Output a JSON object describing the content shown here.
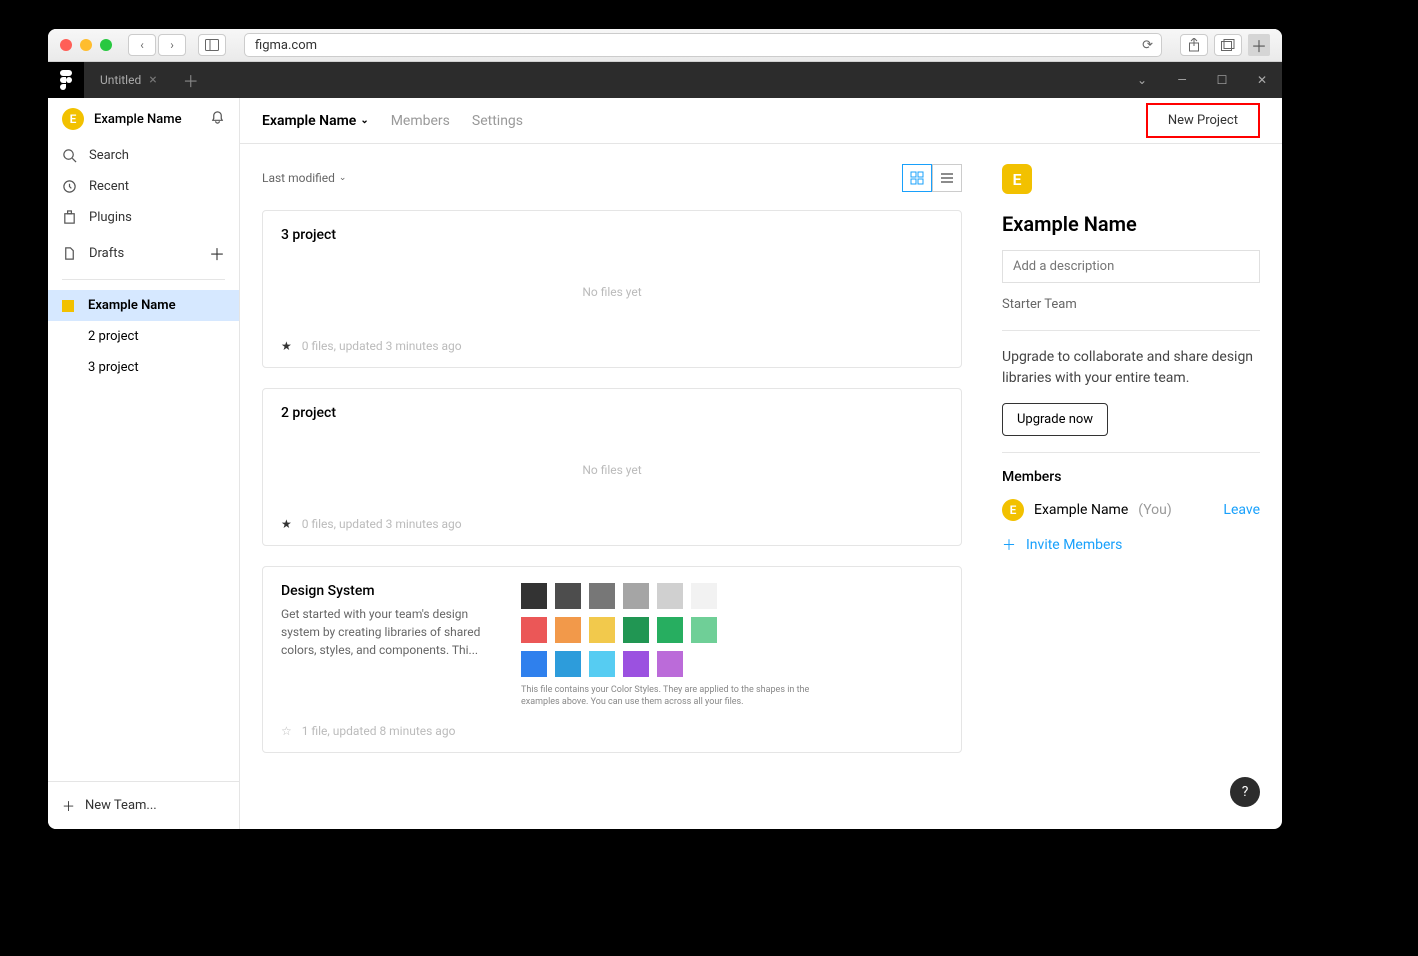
{
  "browser": {
    "url": "figma.com"
  },
  "app_tab": {
    "title": "Untitled"
  },
  "user": {
    "name": "Example Name",
    "initial": "E"
  },
  "sidebar": {
    "search": "Search",
    "recent": "Recent",
    "plugins": "Plugins",
    "drafts": "Drafts",
    "team": "Example Name",
    "projects": [
      "2 project",
      "3 project"
    ],
    "new_team": "New Team..."
  },
  "topbar": {
    "team": "Example Name",
    "members": "Members",
    "settings": "Settings",
    "new_project": "New Project"
  },
  "sort": "Last modified",
  "projects": [
    {
      "title": "3 project",
      "meta": "0 files, updated 3 minutes ago",
      "empty": "No files yet",
      "starred": true
    },
    {
      "title": "2 project",
      "meta": "0 files, updated 3 minutes ago",
      "empty": "No files yet",
      "starred": true
    }
  ],
  "design_system": {
    "title": "Design System",
    "desc": "Get started with your team's design system by creating libraries of shared colors, styles, and components. Thi...",
    "meta": "1 file, updated 8 minutes ago",
    "note": "This file contains your Color Styles. They are applied to the shapes in the examples above. You can use them across all your files.",
    "swatches_row1": [
      "#333333",
      "#4d4d4d",
      "#777777",
      "#a5a5a5",
      "#d0d0d0",
      "#f2f2f2"
    ],
    "swatches_row2": [
      "#eb5757",
      "#f2994a",
      "#f2c94c",
      "#219653",
      "#27ae60",
      "#6fcf97"
    ],
    "swatches_row3": [
      "#2f80ed",
      "#2d9cdb",
      "#56ccf2",
      "#9b51e0",
      "#bb6bd9"
    ]
  },
  "right": {
    "title": "Example Name",
    "desc_placeholder": "Add a description",
    "plan": "Starter Team",
    "upgrade_text": "Upgrade to collaborate and share design libraries with your entire team.",
    "upgrade_btn": "Upgrade now",
    "members_label": "Members",
    "member_name": "Example Name",
    "you": "(You)",
    "leave": "Leave",
    "invite": "Invite Members"
  }
}
